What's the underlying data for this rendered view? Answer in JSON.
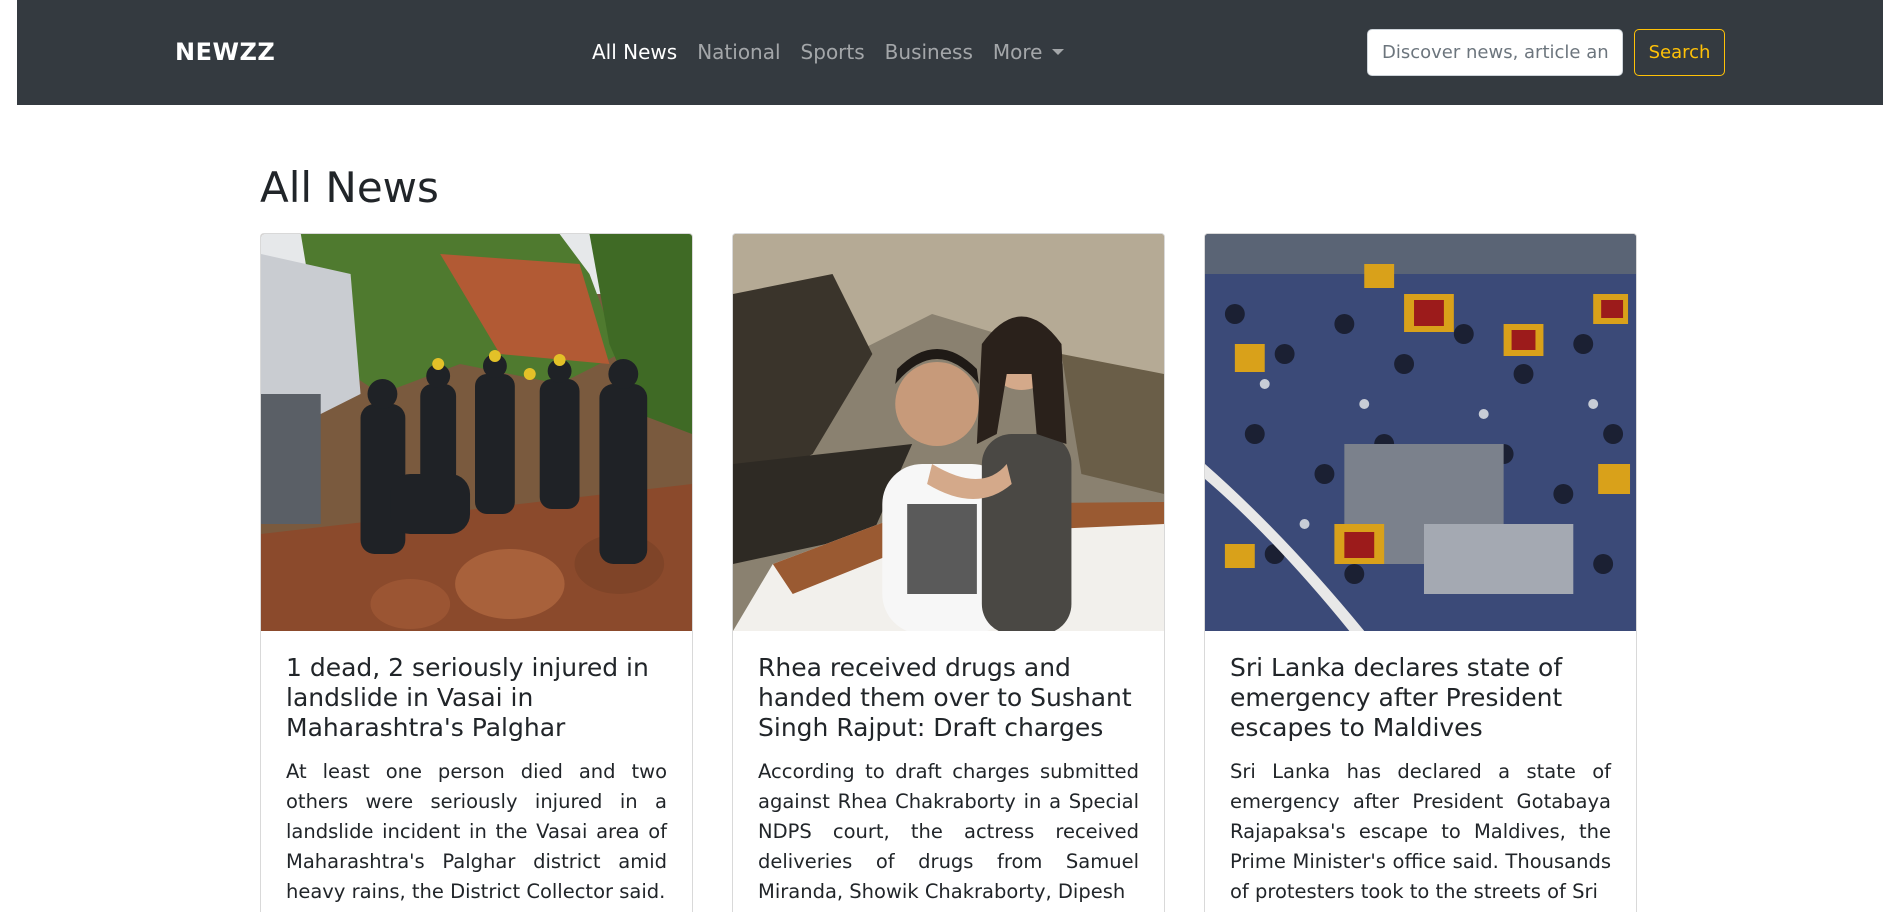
{
  "navbar": {
    "brand": "NEWZZ",
    "links": [
      {
        "label": "All News",
        "active": true
      },
      {
        "label": "National",
        "active": false
      },
      {
        "label": "Sports",
        "active": false
      },
      {
        "label": "Business",
        "active": false
      }
    ],
    "more_label": "More",
    "search": {
      "placeholder": "Discover news, article and more",
      "value": ""
    },
    "search_button": "Search"
  },
  "colors": {
    "navbar_bg": "#343a40",
    "search_accent": "#ffc107",
    "heading_text": "#212529"
  },
  "main": {
    "heading": "All News",
    "cards": [
      {
        "image_icon": "photo-landslide-rescue",
        "title": "1 dead, 2 seriously injured in landslide in Vasai in Maharashtra's Palghar",
        "text": "At least one person died and two others were seriously injured in a landslide incident in the Vasai area of Maharashtra's Palghar district amid heavy rains, the District Collector said."
      },
      {
        "image_icon": "photo-couple-boat",
        "title": "Rhea received drugs and handed them over to Sushant Singh Rajput: Draft charges",
        "text": "According to draft charges submitted against Rhea Chakraborty in a Special NDPS court, the actress received deliveries of drugs from Samuel Miranda, Showik Chakraborty, Dipesh"
      },
      {
        "image_icon": "photo-protest-crowd-flags",
        "title": "Sri Lanka declares state of emergency after President escapes to Maldives",
        "text": "Sri Lanka has declared a state of emergency after President Gotabaya Rajapaksa's escape to Maldives, the Prime Minister's office said. Thousands of protesters took to the streets of Sri"
      }
    ]
  }
}
